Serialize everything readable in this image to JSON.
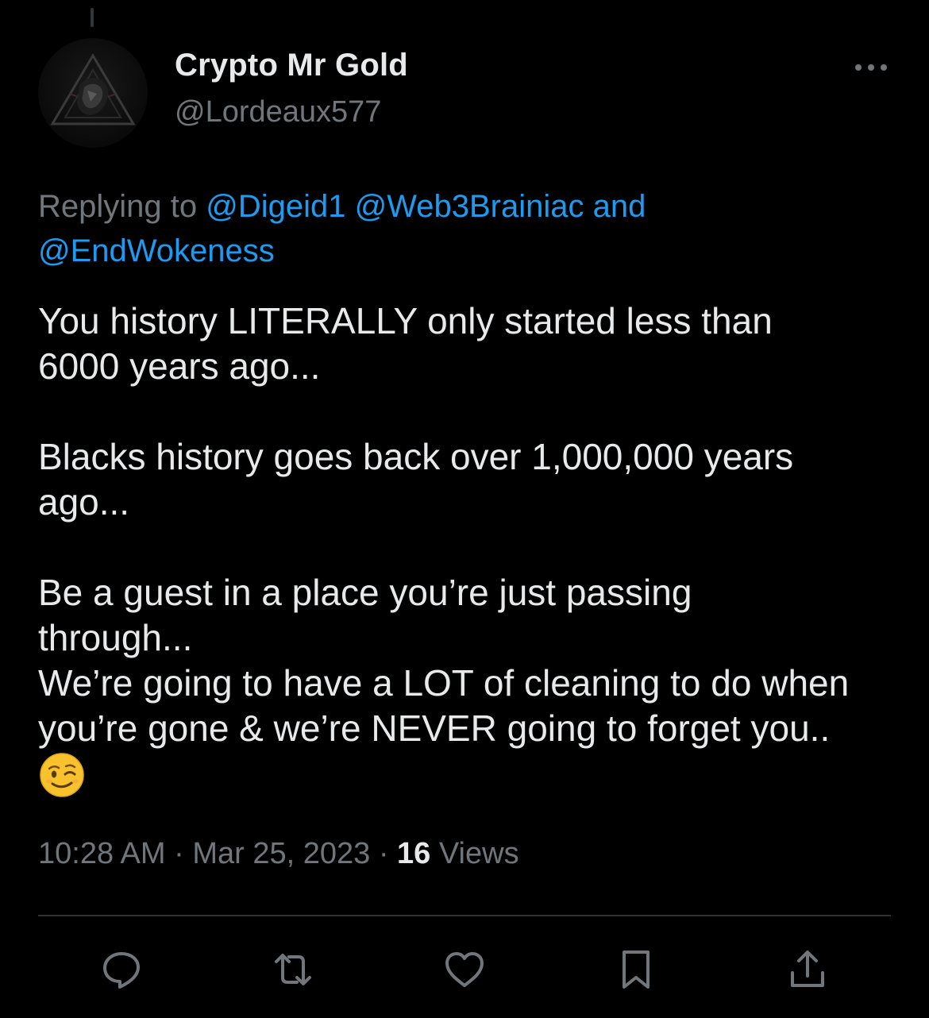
{
  "author": {
    "display_name": "Crypto Mr Gold",
    "handle": "@Lordeaux577"
  },
  "reply": {
    "prefix": "Replying to ",
    "mentions": [
      "@Digeid1",
      "@Web3Brainiac",
      "@EndWokeness"
    ],
    "conjunction": "and"
  },
  "tweet": {
    "paragraph_1": "You history LITERALLY only started less than\n6000 years ago...",
    "paragraph_2": "Blacks history goes back over 1,000,000 years\nago...",
    "paragraph_3": "Be a guest in a place you’re just passing\nthrough...\nWe’re going to have a LOT of cleaning to do when\nyou’re gone & we’re NEVER going to forget you..",
    "emoji": "winking-face"
  },
  "meta": {
    "time": "10:28 AM",
    "separator": " · ",
    "date": "Mar 25, 2023",
    "views_count": "16",
    "views_label": "Views"
  },
  "actions": {
    "reply_icon": "reply-icon",
    "retweet_icon": "retweet-icon",
    "like_icon": "heart-icon",
    "bookmark_icon": "bookmark-icon",
    "share_icon": "share-icon"
  },
  "colors": {
    "background": "#000000",
    "text": "#e7e9ea",
    "secondary": "#71767b",
    "link": "#1d9bf0",
    "divider": "#2f3336"
  }
}
